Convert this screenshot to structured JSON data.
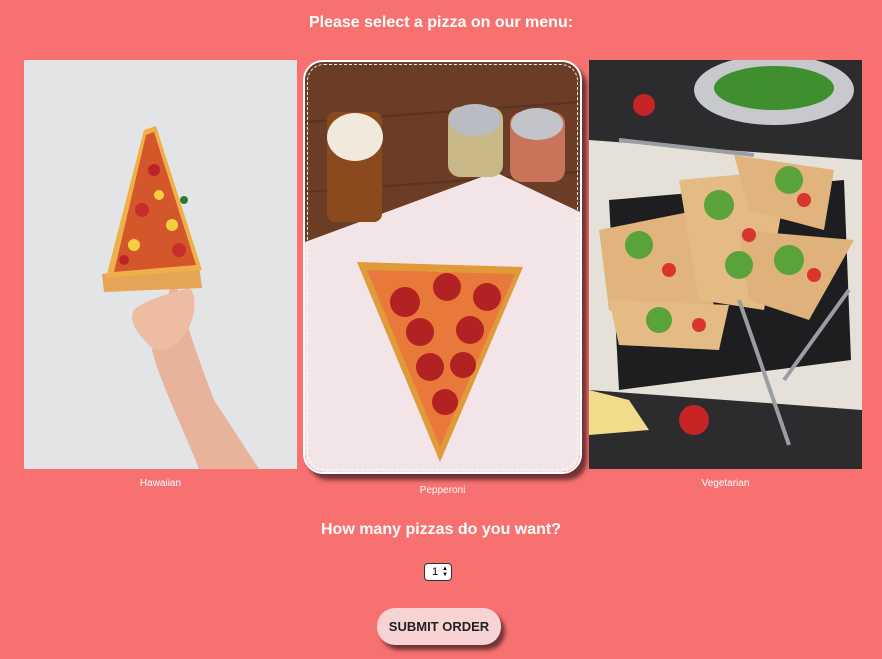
{
  "header": {
    "title": "Please select a pizza on our menu:"
  },
  "menu": {
    "items": [
      {
        "label": "Hawaiian",
        "image": "hand-holding-hawaiian-pizza-slice",
        "selected": false
      },
      {
        "label": "Pepperoni",
        "image": "pepperoni-pizza-slice-with-beer",
        "selected": true
      },
      {
        "label": "Vegetarian",
        "image": "vegetarian-flatbread-pizza-on-slate",
        "selected": false
      }
    ]
  },
  "quantity": {
    "question": "How many pizzas do you want?",
    "selected_value": "1"
  },
  "submit": {
    "label": "SUBMIT ORDER"
  },
  "colors": {
    "background": "#f87171",
    "button": "#f8d3d3"
  }
}
